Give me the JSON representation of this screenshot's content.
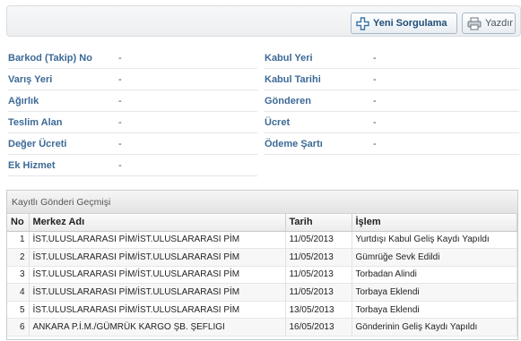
{
  "toolbar": {
    "new_query_label": "Yeni Sorgulama",
    "print_label": "Yazdır",
    "icons": [
      "plus-icon",
      "printer-icon"
    ]
  },
  "fields": {
    "left": [
      {
        "label": "Barkod (Takip) No",
        "value": "-"
      },
      {
        "label": "Varış Yeri",
        "value": "-"
      },
      {
        "label": "Ağırlık",
        "value": "-"
      },
      {
        "label": "Teslim Alan",
        "value": "-"
      },
      {
        "label": "Değer Ücreti",
        "value": "-"
      },
      {
        "label": "Ek Hizmet",
        "value": "-"
      }
    ],
    "right": [
      {
        "label": "Kabul Yeri",
        "value": "-"
      },
      {
        "label": "Kabul Tarihi",
        "value": "-"
      },
      {
        "label": "Gönderen",
        "value": "-"
      },
      {
        "label": "Ücret",
        "value": "-"
      },
      {
        "label": "Ödeme Şartı",
        "value": "-"
      }
    ]
  },
  "history": {
    "title": "Kayıtlı Gönderi Geçmişi",
    "columns": [
      "No",
      "Merkez Adı",
      "Tarih",
      "İşlem"
    ],
    "rows": [
      [
        "1",
        "İST.ULUSLARARASI PİM/İST.ULUSLARARASI PİM",
        "11/05/2013",
        "Yurtdışı Kabul Geliş Kaydı Yapıldı"
      ],
      [
        "2",
        "İST.ULUSLARARASI PİM/İST.ULUSLARARASI PİM",
        "11/05/2013",
        "Gümrüğe Sevk Edildi"
      ],
      [
        "3",
        "İST.ULUSLARARASI PİM/İST.ULUSLARARASI PİM",
        "11/05/2013",
        "Torbadan Alindi"
      ],
      [
        "4",
        "İST.ULUSLARARASI PİM/İST.ULUSLARARASI PİM",
        "11/05/2013",
        "Torbaya Eklendi"
      ],
      [
        "5",
        "İST.ULUSLARARASI PİM/İST.ULUSLARARASI PİM",
        "13/05/2013",
        "Torbaya Eklendi"
      ],
      [
        "6",
        "ANKARA P.İ.M./GÜMRÜK KARGO ŞB. ŞEFLIGI",
        "16/05/2013",
        "Gönderinin Geliş Kaydı Yapıldı"
      ]
    ]
  },
  "colors": {
    "label": "#3d6a96",
    "button_text": "#1f4e79",
    "icon": "#3b73a8"
  }
}
